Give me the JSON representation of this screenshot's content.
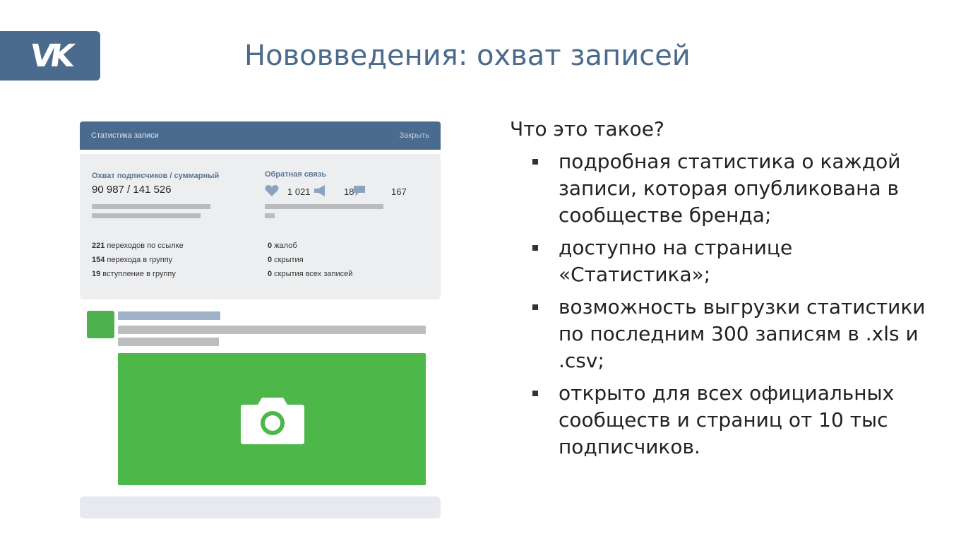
{
  "logo": {
    "text": "VK"
  },
  "title": "Нововведения: охват записей",
  "stats_dialog": {
    "header_title": "Статистика записи",
    "close_label": "Закрыть",
    "reach_label": "Охват подписчиков / суммарный",
    "reach_value": "90 987 / 141 526",
    "feedback_label": "Обратная связь",
    "feedback": [
      {
        "icon": "heart-icon",
        "value": "1 021"
      },
      {
        "icon": "megaphone-icon",
        "value": "18"
      },
      {
        "icon": "comment-icon",
        "value": "167"
      }
    ],
    "left_stats": [
      {
        "num": "221",
        "text": " переходов по ссылке"
      },
      {
        "num": "154",
        "text": " перехода в группу"
      },
      {
        "num": "19",
        "text": " вступление в группу"
      }
    ],
    "right_stats": [
      {
        "num": "0",
        "text": " жалоб"
      },
      {
        "num": "0",
        "text": " скрытия"
      },
      {
        "num": "0",
        "text": " скрытия всех записей"
      }
    ]
  },
  "post": {
    "photo_icon": "camera-icon"
  },
  "info": {
    "heading": "Что это такое?",
    "bullets": [
      "подробная статистика о каждой записи, которая опубликована в сообществе бренда;",
      "доступно на странице «Статистика»;",
      "возможность выгрузки статистики по последним 300 записям в .xls и .csv;",
      "открыто для всех официальных сообществ и страниц от 10 тыс подписчиков."
    ]
  },
  "colors": {
    "brand_blue": "#4a6b8e",
    "green": "#4db74a",
    "panel_gray": "#edeef0",
    "placeholder_gray": "#b9bbbe"
  }
}
